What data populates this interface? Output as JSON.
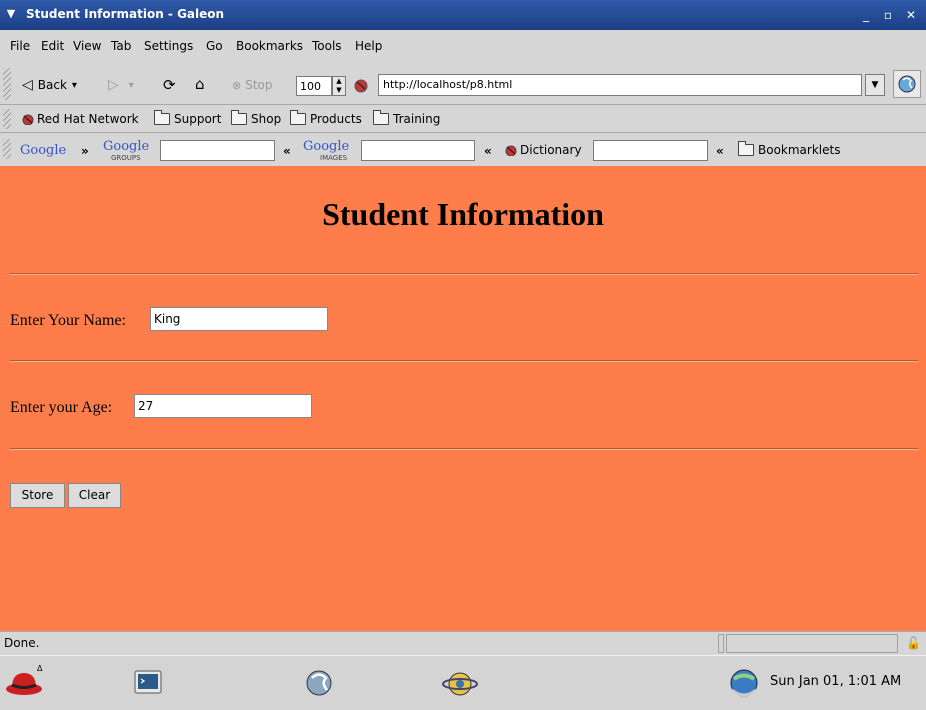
{
  "window": {
    "title": "Student Information - Galeon",
    "controls": [
      "_",
      "▫",
      "✕"
    ]
  },
  "menu": {
    "items": [
      "File",
      "Edit",
      "View",
      "Tab",
      "Settings",
      "Go",
      "Bookmarks",
      "Tools",
      "Help"
    ]
  },
  "toolbar": {
    "back_label": "Back",
    "stop_label": "Stop",
    "zoom": "100",
    "url": "http://localhost/p8.html"
  },
  "bookmarks": {
    "items": [
      "Red Hat Network",
      "Support",
      "Shop",
      "Products",
      "Training"
    ]
  },
  "searchbar": {
    "google": "Google",
    "google_groups": "Google",
    "google_groups_sub": "GROUPS",
    "google_images": "Google",
    "google_images_sub": "IMAGES",
    "arrows": [
      "»",
      "«",
      "«",
      "«"
    ],
    "dictionary": "Dictionary",
    "bookmarklets": "Bookmarklets"
  },
  "page": {
    "heading": "Student Information",
    "name_label": "Enter Your Name:",
    "name_value": "King",
    "age_label": "Enter your Age:",
    "age_value": "27",
    "store_label": "Store",
    "clear_label": "Clear",
    "background": "#fe7d4b"
  },
  "status": {
    "text": "Done."
  },
  "taskbar": {
    "clock": "Sun Jan 01,  1:01 AM"
  }
}
